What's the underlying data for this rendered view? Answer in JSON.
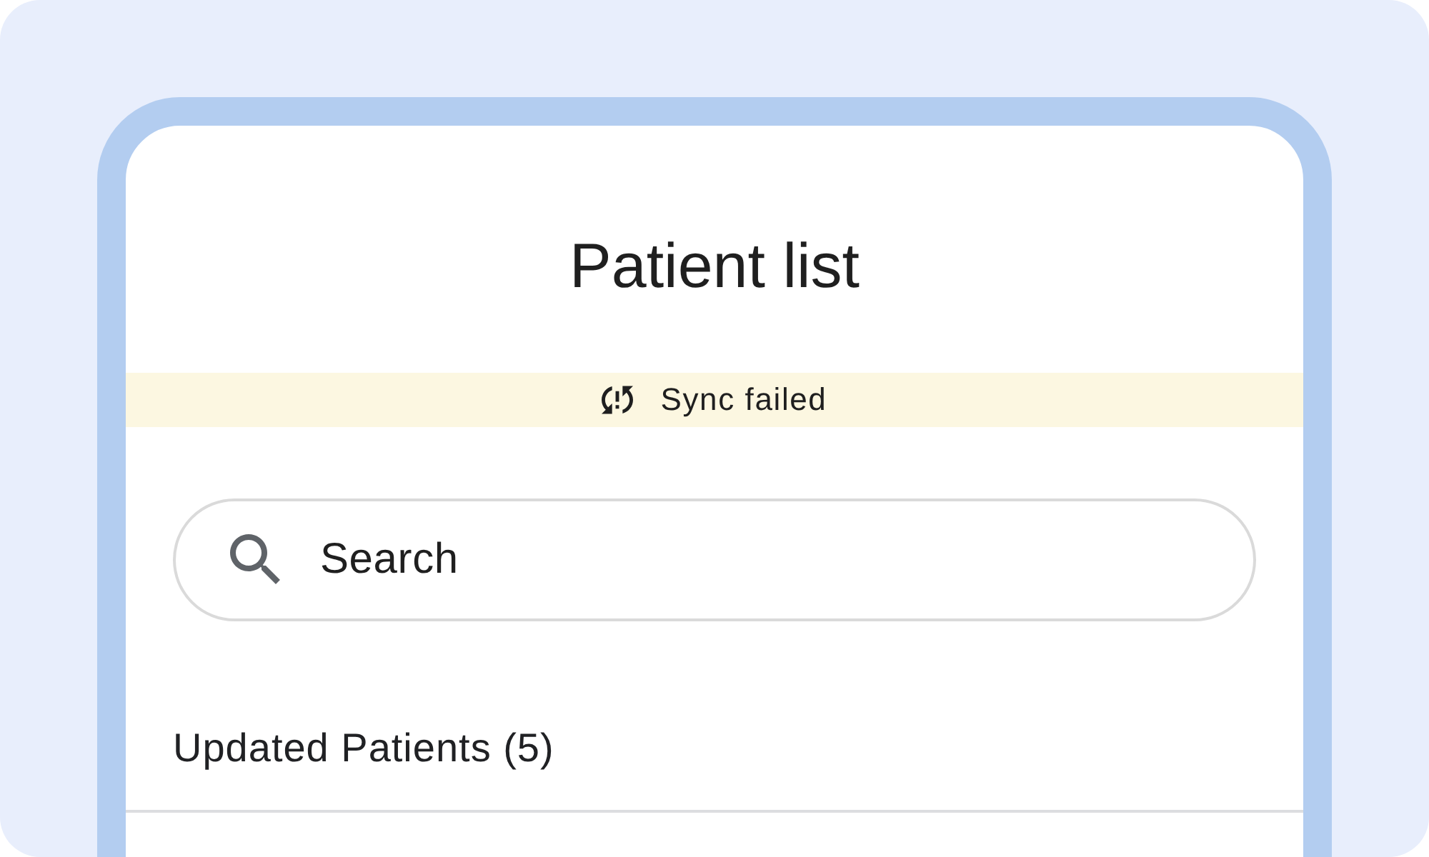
{
  "screen": {
    "title": "Patient list"
  },
  "sync_banner": {
    "message": "Sync failed"
  },
  "search": {
    "placeholder": "Search"
  },
  "section": {
    "heading": "Updated Patients (5)"
  }
}
